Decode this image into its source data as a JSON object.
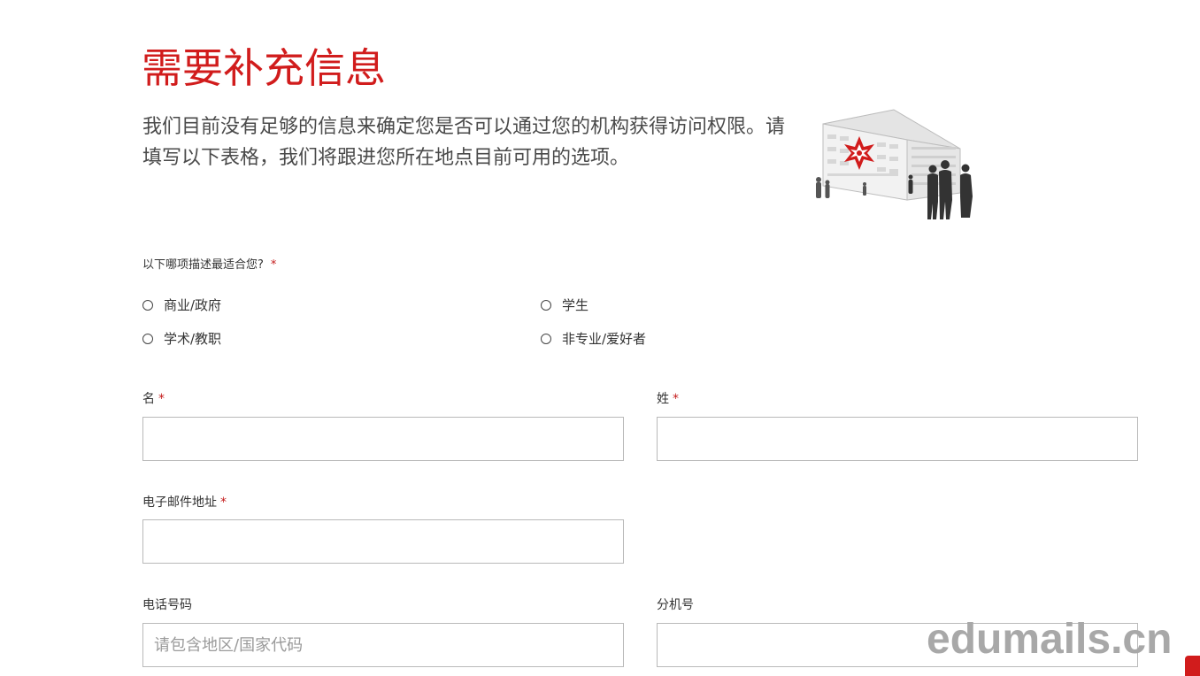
{
  "page": {
    "title": "需要补充信息",
    "intro": "我们目前没有足够的信息来确定您是否可以通过您的机构获得访问权限。请填写以下表格，我们将跟进您所在地点目前可用的选项。"
  },
  "question": {
    "label": "以下哪项描述最适合您?",
    "required_mark": "*",
    "options": [
      {
        "label": "商业/政府",
        "selected": false
      },
      {
        "label": "学生",
        "selected": false
      },
      {
        "label": "学术/教职",
        "selected": false
      },
      {
        "label": "非专业/爱好者",
        "selected": false
      }
    ]
  },
  "form": {
    "first_name": {
      "label": "名",
      "required_mark": "*",
      "value": "",
      "placeholder": ""
    },
    "last_name": {
      "label": "姓",
      "required_mark": "*",
      "value": "",
      "placeholder": ""
    },
    "email": {
      "label": "电子邮件地址",
      "required_mark": "*",
      "value": "",
      "placeholder": ""
    },
    "phone": {
      "label": "电话号码",
      "value": "",
      "placeholder": "请包含地区/国家代码"
    },
    "extension": {
      "label": "分机号",
      "value": "",
      "placeholder": ""
    }
  },
  "watermark": {
    "text": "edumails.cn"
  },
  "colors": {
    "accent": "#d11c1c",
    "required": "#c41a1a",
    "input_border": "#b9b9b9",
    "watermark": "#a8a8a8"
  },
  "icons": {
    "illustration": "building-with-people-illustration",
    "radio": "radio-button-unchecked"
  }
}
